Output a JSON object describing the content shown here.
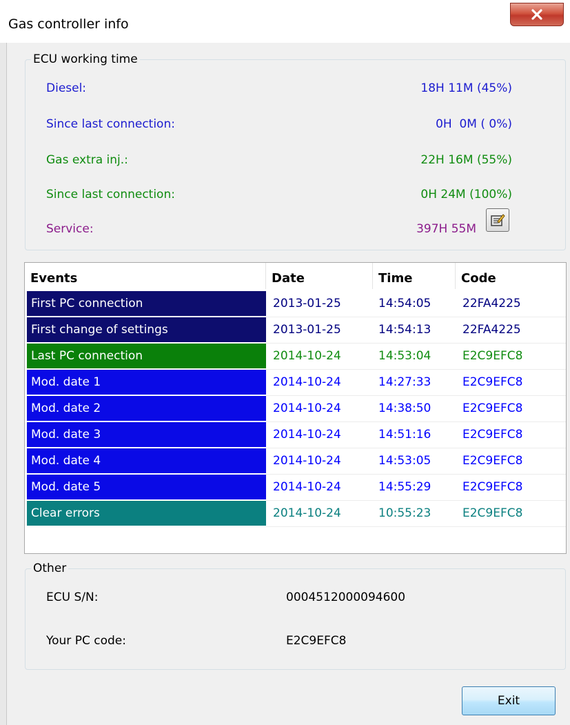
{
  "window": {
    "title": "Gas controller info"
  },
  "ecu_working_time": {
    "legend": "ECU working time",
    "rows": [
      {
        "label": "Diesel:",
        "value": "18H 11M (45%)",
        "color": "#1c1ccf"
      },
      {
        "label": "Since last connection:",
        "value": "0H  0M ( 0%)",
        "color": "#1c1ccf"
      },
      {
        "label": "Gas extra inj.:",
        "value": "22H 16M (55%)",
        "color": "#108c10"
      },
      {
        "label": "Since last connection:",
        "value": "0H 24M (100%)",
        "color": "#108c10"
      },
      {
        "label": "Service:",
        "value": "397H 55M",
        "color": "#8b1c8b"
      }
    ],
    "service_button_icon": "edit-form-icon"
  },
  "events_table": {
    "headers": {
      "events": "Events",
      "date": "Date",
      "time": "Time",
      "code": "Code"
    },
    "rows": [
      {
        "event": "First PC connection",
        "date": "2013-01-25",
        "time": "14:54:05",
        "code": "22FA4225",
        "bg": "#0d0d6e",
        "fg": "#000080"
      },
      {
        "event": "First change of settings",
        "date": "2013-01-25",
        "time": "14:54:13",
        "code": "22FA4225",
        "bg": "#0d0d6e",
        "fg": "#000080"
      },
      {
        "event": "Last PC connection",
        "date": "2014-10-24",
        "time": "14:53:04",
        "code": "E2C9EFC8",
        "bg": "#0a800a",
        "fg": "#108c10"
      },
      {
        "event": "Mod. date 1",
        "date": "2014-10-24",
        "time": "14:27:33",
        "code": "E2C9EFC8",
        "bg": "#0a0ae6",
        "fg": "#0000ff"
      },
      {
        "event": "Mod. date 2",
        "date": "2014-10-24",
        "time": "14:38:50",
        "code": "E2C9EFC8",
        "bg": "#0a0ae6",
        "fg": "#0000ff"
      },
      {
        "event": "Mod. date 3",
        "date": "2014-10-24",
        "time": "14:51:16",
        "code": "E2C9EFC8",
        "bg": "#0a0ae6",
        "fg": "#0000ff"
      },
      {
        "event": "Mod. date 4",
        "date": "2014-10-24",
        "time": "14:53:05",
        "code": "E2C9EFC8",
        "bg": "#0a0ae6",
        "fg": "#0000ff"
      },
      {
        "event": "Mod. date 5",
        "date": "2014-10-24",
        "time": "14:55:29",
        "code": "E2C9EFC8",
        "bg": "#0a0ae6",
        "fg": "#0000ff"
      },
      {
        "event": "Clear errors",
        "date": "2014-10-24",
        "time": "10:55:23",
        "code": "E2C9EFC8",
        "bg": "#0b8080",
        "fg": "#0b8080"
      }
    ]
  },
  "other": {
    "legend": "Other",
    "ecu_sn_label": "ECU S/N:",
    "ecu_sn_value": "0004512000094600",
    "pc_code_label": "Your PC code:",
    "pc_code_value": "E2C9EFC8"
  },
  "buttons": {
    "exit": "Exit",
    "close_icon": "close-icon"
  }
}
